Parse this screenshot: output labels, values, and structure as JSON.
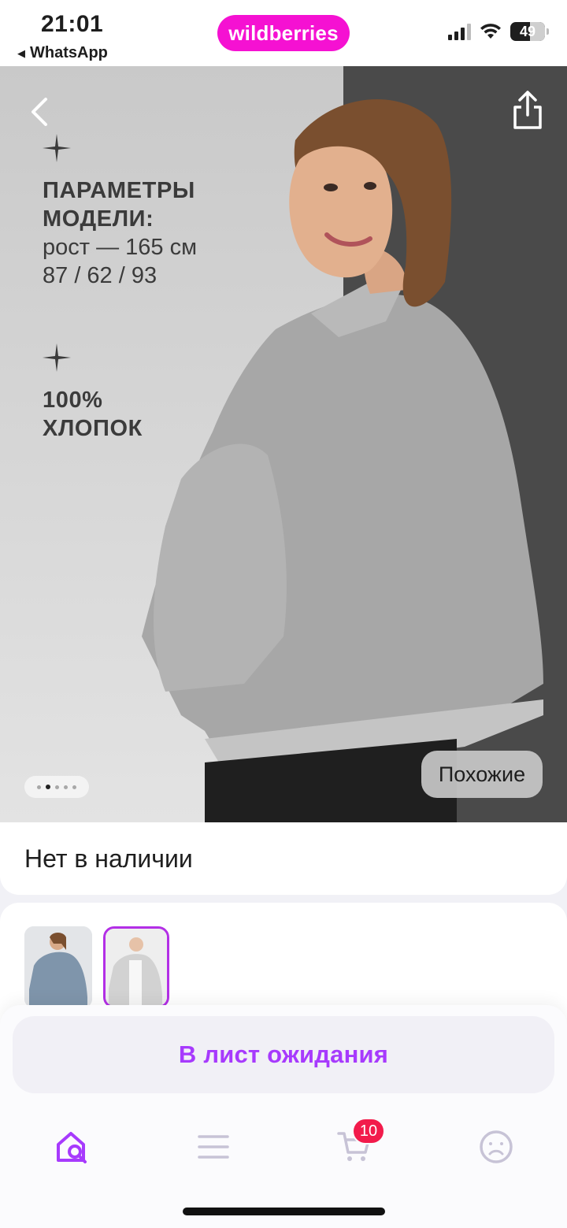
{
  "status_bar": {
    "time": "21:01",
    "back_app": "WhatsApp",
    "brand": "wildberries",
    "battery_level": "49",
    "icons": [
      "signal-icon",
      "wifi-icon",
      "battery-icon"
    ]
  },
  "hero": {
    "params_heading_line1": "ПАРАМЕТРЫ",
    "params_heading_line2": "МОДЕЛИ:",
    "params_height": "рост — 165 см",
    "params_measurements": "87 / 62 / 93",
    "cotton_line1": "100%",
    "cotton_line2": "ХЛОПОК",
    "similar_label": "Похожие",
    "page_dots_count": 5,
    "page_dots_active": 2,
    "icons": [
      "back-chevron-icon",
      "share-icon",
      "sparkle-icon"
    ]
  },
  "stock": {
    "status_text": "Нет в наличии"
  },
  "variants": {
    "selected_index": 2,
    "count": 2
  },
  "sheet": {
    "wait_button_label": "В лист ожидания"
  },
  "tabbar": {
    "cart_badge": "10",
    "items": [
      "home-search-icon",
      "catalog-menu-icon",
      "cart-icon",
      "profile-icon"
    ]
  },
  "colors": {
    "brand": "#f511d2",
    "accent": "#a73afd",
    "badge": "#f21b4b",
    "selected_border": "#b32fe6"
  }
}
